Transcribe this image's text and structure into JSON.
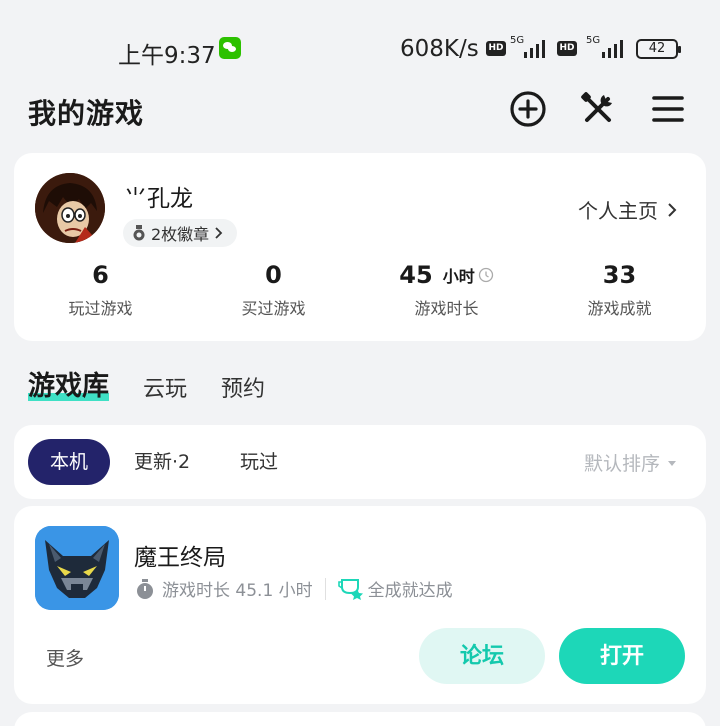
{
  "status_bar": {
    "time": "上午9:37",
    "net_speed": "608K/s",
    "hd_label": "HD",
    "fiveg_label": "5G",
    "battery": "42"
  },
  "header": {
    "title": "我的游戏",
    "icons": [
      "add-circle-icon",
      "tools-icon",
      "menu-icon"
    ]
  },
  "profile": {
    "username": "⺌孔龙",
    "badge_text": "2枚徽章",
    "home_link": "个人主页",
    "stats": [
      {
        "value": "6",
        "unit": "",
        "label": "玩过游戏"
      },
      {
        "value": "0",
        "unit": "",
        "label": "买过游戏"
      },
      {
        "value": "45",
        "unit": "小时",
        "label": "游戏时长"
      },
      {
        "value": "33",
        "unit": "",
        "label": "游戏成就"
      }
    ]
  },
  "tabs": [
    {
      "label": "游戏库",
      "active": true
    },
    {
      "label": "云玩",
      "active": false
    },
    {
      "label": "预约",
      "active": false
    }
  ],
  "filters": {
    "chips": [
      "本机",
      "更新·2",
      "玩过"
    ],
    "active": "本机",
    "sort_label": "默认排序"
  },
  "game": {
    "title": "魔王终局",
    "playtime": "游戏时长 45.1 小时",
    "achievement": "全成就达成",
    "more_label": "更多",
    "forum_label": "论坛",
    "open_label": "打开"
  },
  "colors": {
    "accent": "#1dd7b8",
    "chip_active": "#23236a",
    "forum_bg": "#e0f7f3"
  }
}
